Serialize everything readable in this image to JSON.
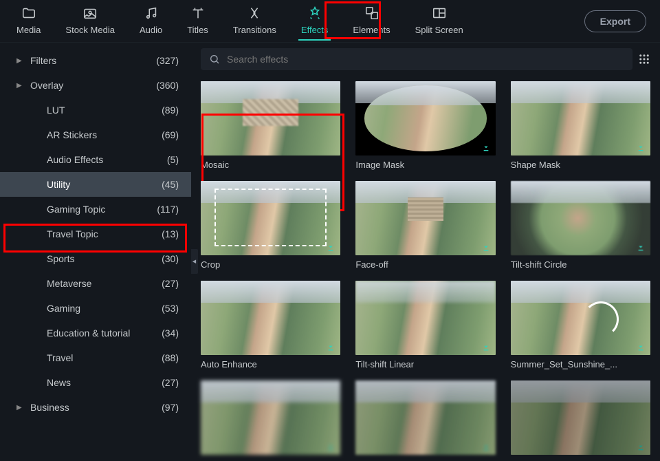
{
  "export_label": "Export",
  "search_placeholder": "Search effects",
  "top_tabs": [
    {
      "label": "Media"
    },
    {
      "label": "Stock Media"
    },
    {
      "label": "Audio"
    },
    {
      "label": "Titles"
    },
    {
      "label": "Transitions"
    },
    {
      "label": "Effects"
    },
    {
      "label": "Elements"
    },
    {
      "label": "Split Screen"
    }
  ],
  "active_top_tab": 5,
  "sidebar": [
    {
      "label": "Filters",
      "count": "(327)",
      "child": false,
      "chevron": true
    },
    {
      "label": "Overlay",
      "count": "(360)",
      "child": false,
      "chevron": true
    },
    {
      "label": "LUT",
      "count": "(89)",
      "child": true,
      "chevron": false
    },
    {
      "label": "AR Stickers",
      "count": "(69)",
      "child": true,
      "chevron": false
    },
    {
      "label": "Audio Effects",
      "count": "(5)",
      "child": true,
      "chevron": false
    },
    {
      "label": "Utility",
      "count": "(45)",
      "child": true,
      "chevron": false,
      "selected": true
    },
    {
      "label": "Gaming Topic",
      "count": "(117)",
      "child": true,
      "chevron": false
    },
    {
      "label": "Travel Topic",
      "count": "(13)",
      "child": true,
      "chevron": false
    },
    {
      "label": "Sports",
      "count": "(30)",
      "child": true,
      "chevron": false
    },
    {
      "label": "Metaverse",
      "count": "(27)",
      "child": true,
      "chevron": false
    },
    {
      "label": "Gaming",
      "count": "(53)",
      "child": true,
      "chevron": false
    },
    {
      "label": "Education & tutorial",
      "count": "(34)",
      "child": true,
      "chevron": false
    },
    {
      "label": "Travel",
      "count": "(88)",
      "child": true,
      "chevron": false
    },
    {
      "label": "News",
      "count": "(27)",
      "child": true,
      "chevron": false
    },
    {
      "label": "Business",
      "count": "(97)",
      "child": false,
      "chevron": true
    }
  ],
  "effects": [
    {
      "title": "Mosaic",
      "variant": "mosaic",
      "download": false,
      "highlight": true
    },
    {
      "title": "Image Mask",
      "variant": "imagemask",
      "download": true
    },
    {
      "title": "Shape Mask",
      "variant": "",
      "download": true
    },
    {
      "title": "Crop",
      "variant": "crop",
      "download": true
    },
    {
      "title": "Face-off",
      "variant": "faceoff",
      "download": true
    },
    {
      "title": "Tilt-shift Circle",
      "variant": "tiltc",
      "download": true
    },
    {
      "title": "Auto Enhance",
      "variant": "",
      "download": true
    },
    {
      "title": "Tilt-shift Linear",
      "variant": "tiltl",
      "download": true
    },
    {
      "title": "Summer_Set_Sunshine_...",
      "variant": "sunshine",
      "download": true
    },
    {
      "title": "",
      "variant": "blur1",
      "download": true
    },
    {
      "title": "",
      "variant": "blur2",
      "download": true
    },
    {
      "title": "",
      "variant": "blur3",
      "download": true
    }
  ],
  "accent": "#2dd4bf"
}
